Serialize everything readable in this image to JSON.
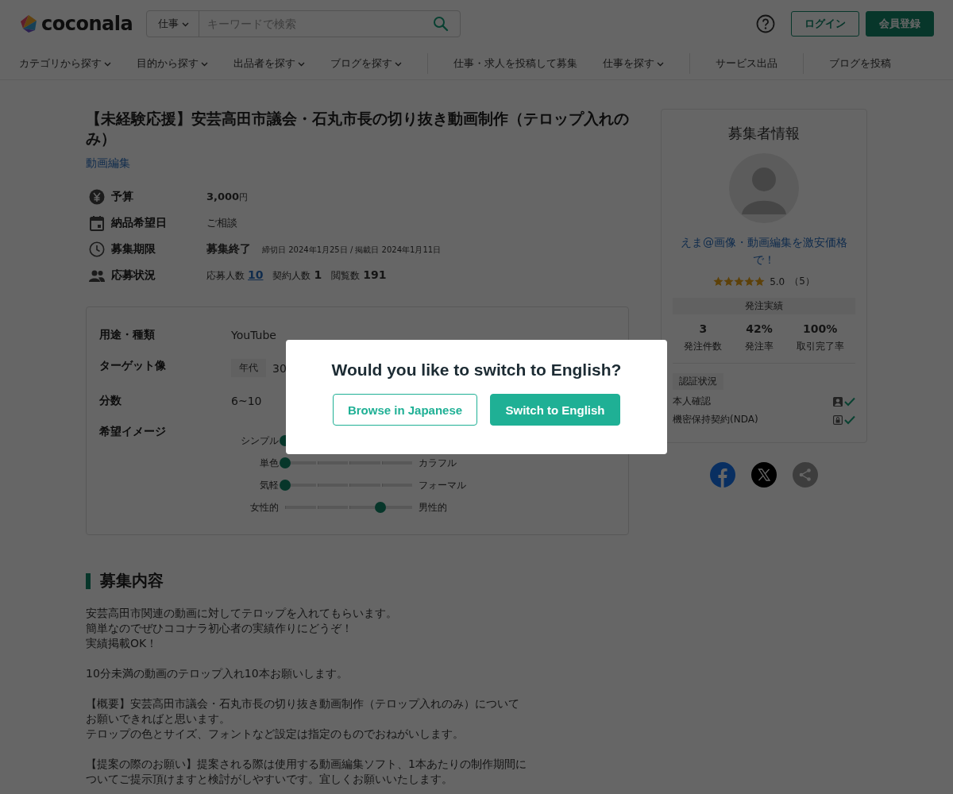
{
  "header": {
    "logo": "coconala",
    "search": {
      "scope": "仕事",
      "placeholder": "キーワードで検索"
    },
    "login": "ログイン",
    "signup": "会員登録"
  },
  "nav": [
    {
      "label": "カテゴリから探す",
      "dropdown": true,
      "separator_before": false
    },
    {
      "label": "目的から探す",
      "dropdown": true,
      "separator_before": false
    },
    {
      "label": "出品者を探す",
      "dropdown": true,
      "separator_before": false
    },
    {
      "label": "ブログを探す",
      "dropdown": true,
      "separator_before": false
    },
    {
      "label": "仕事・求人を投稿して募集",
      "dropdown": false,
      "separator_before": true
    },
    {
      "label": "仕事を探す",
      "dropdown": true,
      "separator_before": false
    },
    {
      "label": "サービス出品",
      "dropdown": false,
      "separator_before": true
    },
    {
      "label": "ブログを投稿",
      "dropdown": false,
      "separator_before": true
    }
  ],
  "job": {
    "title": "【未経験応援】安芸高田市議会・石丸市長の切り抜き動画制作（テロップ入れのみ）",
    "category": "動画編集",
    "info": [
      {
        "kind": "budget",
        "label": "予算",
        "value": "3,000",
        "unit": "円"
      },
      {
        "kind": "deadline",
        "label": "納品希望日",
        "value": "ご相談"
      },
      {
        "kind": "period",
        "label": "募集期限",
        "value": "募集終了",
        "note": "締切日 2024年1月25日 / 掲載日 2024年1月11日"
      },
      {
        "kind": "status",
        "label": "応募状況",
        "stats": [
          {
            "label": "応募人数",
            "value": "10",
            "link": true
          },
          {
            "label": "契約人数",
            "value": "1",
            "link": false
          },
          {
            "label": "閲覧数",
            "value": "191",
            "link": false
          }
        ]
      }
    ],
    "specs": [
      {
        "kind": "text",
        "label": "用途・種類",
        "value": "YouTube"
      },
      {
        "kind": "tagged",
        "label": "ターゲット像",
        "tag": "年代",
        "value": "30"
      },
      {
        "kind": "text",
        "label": "分数",
        "value": "6~10"
      },
      {
        "kind": "sliders",
        "label": "希望イメージ",
        "sliders": [
          {
            "left": "シンプル",
            "level": 0
          },
          {
            "left": "単色",
            "right": "カラフル",
            "level": 0
          },
          {
            "left": "気軽",
            "right": "フォーマル",
            "level": 0
          },
          {
            "left": "女性的",
            "right": "男性的",
            "level": 0.75
          }
        ]
      }
    ],
    "section_title": "募集内容",
    "description": [
      [
        "安芸高田市関連の動画に対してテロップを入れてもらいます。",
        "簡単なのでぜひココナラ初心者の実績作りにどうぞ！",
        "実績掲載OK！"
      ],
      [
        "10分未満の動画のテロップ入れ10本お願いします。"
      ],
      [
        "【概要】安芸高田市議会・石丸市長の切り抜き動画制作（テロップ入れのみ）についてお願いできればと思います。",
        "テロップの色とサイズ、フォントなど設定は指定のものでおねがいします。"
      ],
      [
        "【提案の際のお願い】提案される際は使用する動画編集ソフト、1本あたりの制作期間についてご提示頂けますと検討がしやすいです。宜しくお願いいたします。"
      ]
    ]
  },
  "client": {
    "heading": "募集者情報",
    "name": "えま@画像・動画編集を激安価格で！",
    "stars": 5,
    "rating": "5.0",
    "reviews": "（5）",
    "record_heading": "発注実績",
    "stats": [
      {
        "value": "3",
        "label": "発注件数"
      },
      {
        "value": "42%",
        "label": "発注率"
      },
      {
        "value": "100%",
        "label": "取引完了率"
      }
    ],
    "verification_heading": "認証状況",
    "verifications": [
      {
        "kind": "identity",
        "label": "本人確認",
        "verified": true
      },
      {
        "kind": "nda",
        "label": "機密保持契約(NDA)",
        "verified": true
      }
    ]
  },
  "share": [
    {
      "kind": "facebook"
    },
    {
      "kind": "x"
    },
    {
      "kind": "share"
    }
  ],
  "dialog": {
    "title": "Would you like to switch to English?",
    "buttons": [
      {
        "label": "Browse in Japanese",
        "primary": false
      },
      {
        "label": "Switch to English",
        "primary": true
      }
    ]
  }
}
